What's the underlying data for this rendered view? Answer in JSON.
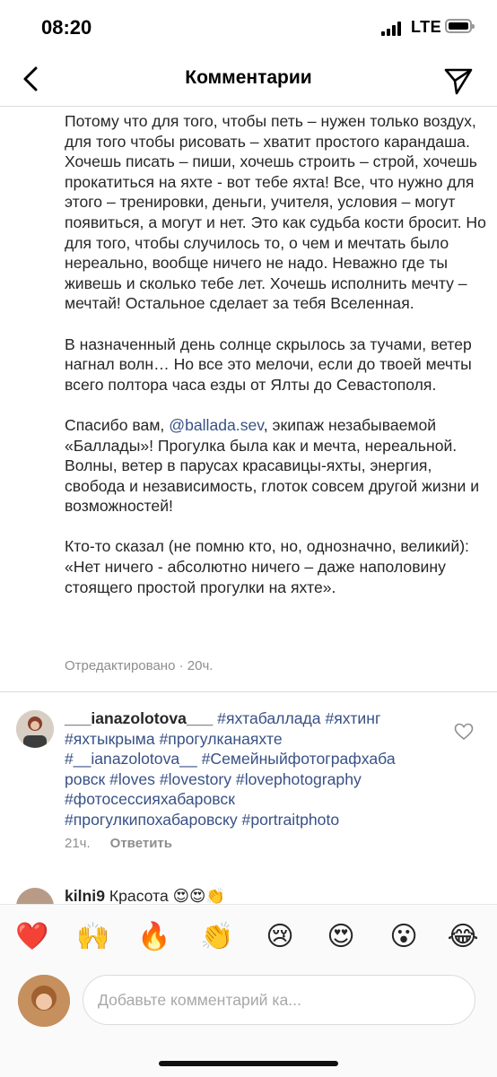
{
  "status": {
    "time": "08:20",
    "network": "LTE",
    "battery": 1.0
  },
  "header": {
    "title": "Комментарии",
    "back_icon": "chevron-left-icon",
    "send_icon": "paper-plane-icon"
  },
  "caption": {
    "p1": "Потому что для того, чтобы петь – нужен только воздух, для того чтобы рисовать – хватит простого карандаша. Хочешь писать – пиши, хочешь строить – строй, хочешь прокатиться на яхте - вот тебе яхта! Все, что нужно для этого – тренировки, деньги, учителя, условия – могут появиться, а могут и нет. Это как судьба кости бросит. Но для того, чтобы случилось то, о чем и мечтать было нереально, вообще ничего не надо. Неважно где ты живешь и сколько тебе лет. Хочешь исполнить мечту – мечтай!  Остальное сделает за тебя Вселенная.",
    "p2": "В назначенный день солнце скрылось за тучами, ветер нагнал волн… Но все это мелочи, если до твоей мечты всего полтора часа езды от Ялты до Севастополя.",
    "p3_prefix": "Спасибо вам, ",
    "p3_mention": "@ballada.sev",
    "p3_suffix": ", экипаж незабываемой «Баллады»! Прогулка была как и мечта, нереальной. Волны, ветер в парусах красавицы-яхты, энергия, свобода и независимость, глоток совсем другой жизни и возможностей!",
    "p4": "Кто-то сказал (не помню кто, но, однозначно, великий): «Нет ничего -  абсолютно ничего – даже наполовину стоящего простой прогулки на яхте».",
    "edited": "Отредактировано",
    "separator": " · ",
    "time": "20ч."
  },
  "comment": {
    "username": "___ianazolotova___",
    "tags_line1": " #яхтабаллада #яхтинг",
    "tags_line2": "#яхтыкрыма #прогулканаяхте",
    "tags_line3": "#__ianazolotova__ #Семейныйфотографхаба",
    "tags_line4": "ровск #loves #lovestory #lovephotography",
    "tags_line5": "#фотосессияхабаровск",
    "tags_line6": "#прогулкипохабаровску #portraitphoto",
    "time": "21ч.",
    "reply": "Ответить",
    "like_icon": "heart-outline-icon"
  },
  "comment2": {
    "username": "kilni9",
    "text": " Красота 😍😍👏"
  },
  "emojis": [
    "❤️",
    "🙌",
    "🔥",
    "👏",
    "😢",
    "😍",
    "😮",
    "😂"
  ],
  "input": {
    "placeholder": "Добавьте комментарий ка..."
  }
}
